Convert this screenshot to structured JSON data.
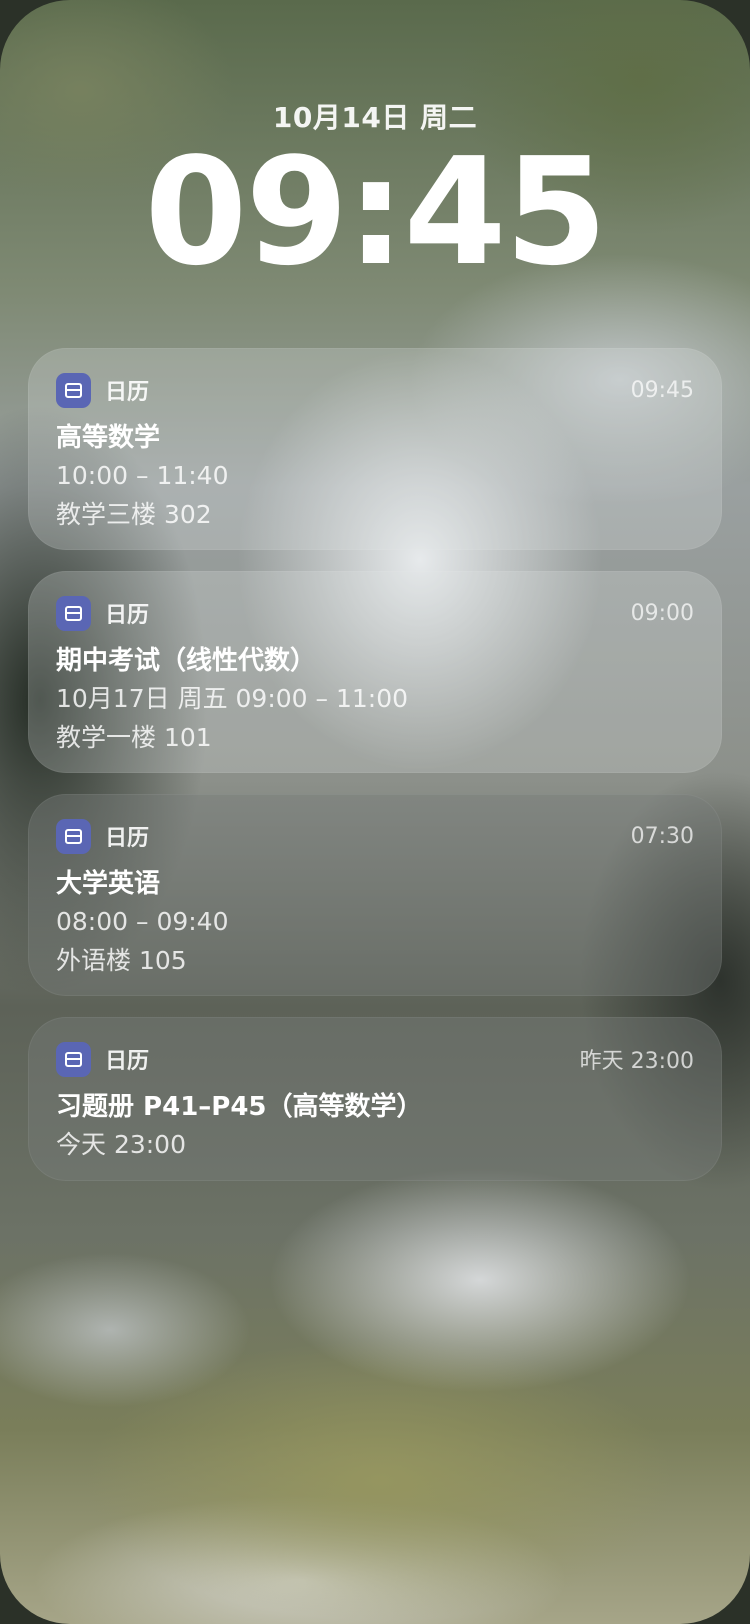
{
  "lockscreen": {
    "date": "10月14日 周二",
    "time": "09:45"
  },
  "notifications": [
    {
      "app": "日历",
      "time": "09:45",
      "title": "高等数学",
      "lines": [
        "10:00 – 11:40",
        "教学三楼 302"
      ]
    },
    {
      "app": "日历",
      "time": "09:00",
      "title": "期中考试（线性代数）",
      "lines": [
        "10月17日 周五 09:00 – 11:00",
        "教学一楼 101"
      ]
    },
    {
      "app": "日历",
      "time": "07:30",
      "title": "大学英语",
      "lines": [
        "08:00 – 09:40",
        "外语楼 105"
      ]
    },
    {
      "app": "日历",
      "time": "昨天 23:00",
      "title": "习题册 P41–P45（高等数学）",
      "lines": [
        "今天 23:00"
      ]
    }
  ],
  "icons": {
    "app_icon": "calendar-icon"
  },
  "colors": {
    "app_icon_bg": "#5a66b4"
  }
}
